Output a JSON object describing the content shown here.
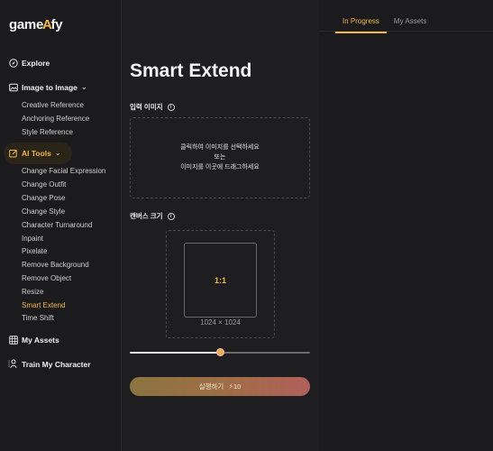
{
  "app": {
    "logo_left": "game",
    "logo_mid": "A",
    "logo_right": "fy"
  },
  "sidebar": {
    "explore": "Explore",
    "image_to_image": "Image to Image",
    "image_to_image_items": [
      "Creative Reference",
      "Anchoring Reference",
      "Style Reference"
    ],
    "ai_tools": "AI Tools",
    "ai_tools_items": [
      "Change Facial Expression",
      "Change Outfit",
      "Change Pose",
      "Change Style",
      "Character Turnaround",
      "Inpaint",
      "Pixelate",
      "Remove Background",
      "Remove Object",
      "Resize",
      "Smart Extend",
      "Time Shift"
    ],
    "my_assets": "My Assets",
    "train_my_character": "Train My Character"
  },
  "main": {
    "title": "Smart Extend",
    "input_label": "입력 이미지",
    "upload_line1": "클릭하여 이미지를 선택하세요",
    "upload_line2": "또는",
    "upload_line3": "이미지를 이곳에 드래그하세요",
    "canvas_label": "캔버스 크기",
    "ratio": "1:1",
    "canvas_size": "1024 × 1024",
    "slider_fraction": 0.5,
    "run_label": "실행하기",
    "run_cost": "10"
  },
  "right": {
    "tabs": [
      "In Progress",
      "My Assets"
    ]
  },
  "colors": {
    "accent": "#f0b84a"
  }
}
